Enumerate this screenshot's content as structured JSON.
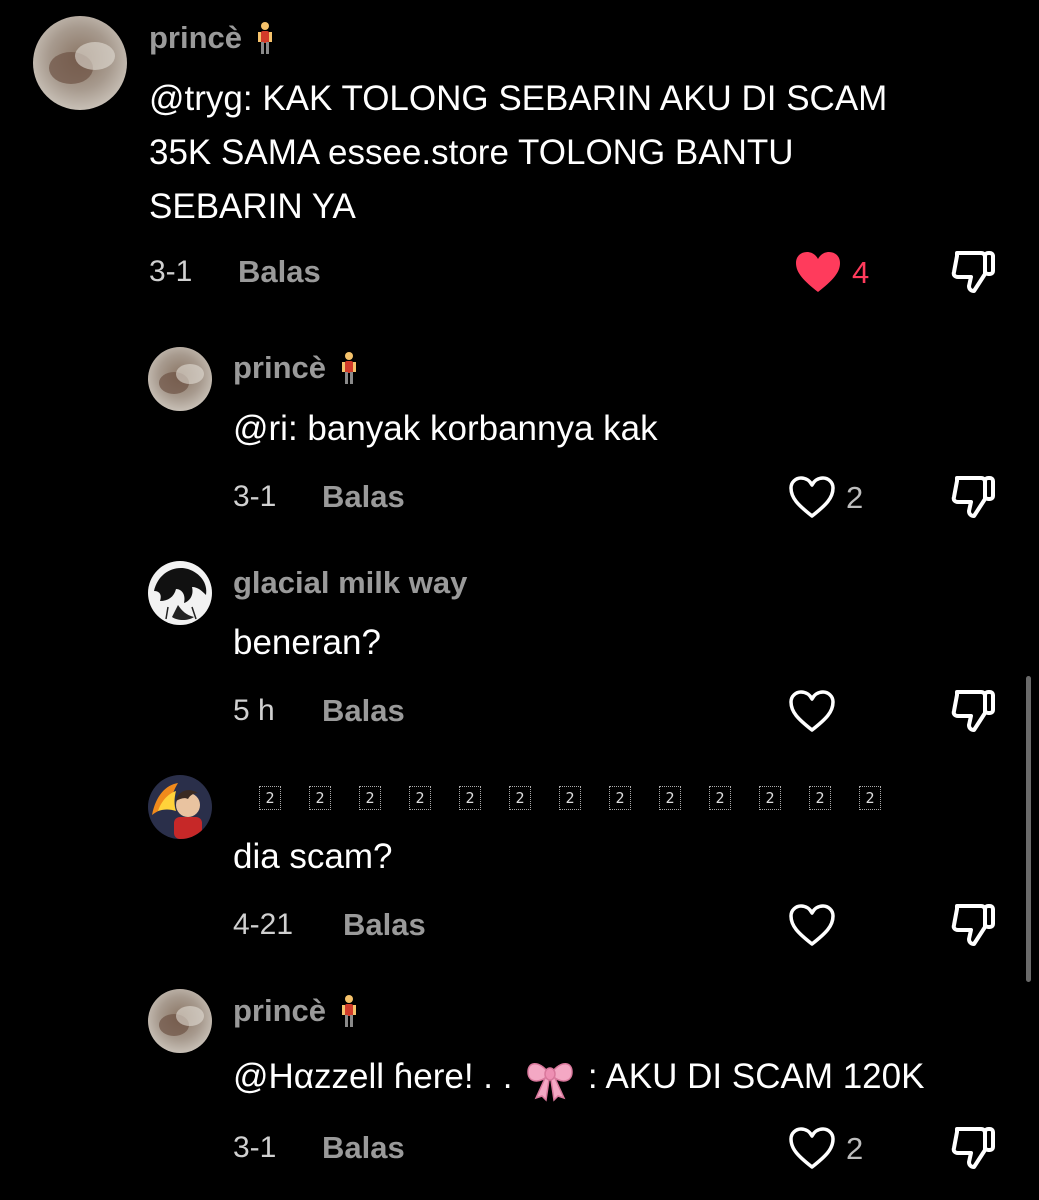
{
  "comments": [
    {
      "username": "princè",
      "text_lines": [
        "@tryg: KAK TOLONG SEBARIN AKU DI SCAM",
        "35K SAMA essee.store TOLONG BANTU",
        "SEBARIN YA"
      ],
      "time": "3-1",
      "reply_label": "Balas",
      "likes": "4",
      "liked": true
    },
    {
      "username": "princè",
      "text": "@ri: banyak korbannya kak",
      "time": "3-1",
      "reply_label": "Balas",
      "likes": "2",
      "liked": false
    },
    {
      "username": "glacial milk way",
      "text": "beneran?",
      "time": "5 h",
      "reply_label": "Balas",
      "likes": "",
      "liked": false
    },
    {
      "username_glyphs": [
        "2",
        "2",
        "2",
        "2",
        "2",
        "2",
        "2",
        "2",
        "2",
        "2",
        "2",
        "2",
        "2"
      ],
      "text": "dia scam?",
      "time": "4-21",
      "reply_label": "Balas",
      "likes": "",
      "liked": false
    },
    {
      "username": "princè",
      "text_prefix": "@Hαzzell ɦere! . .",
      "text_suffix": ": AKU DI SCAM 120K",
      "time": "3-1",
      "reply_label": "Balas",
      "likes": "2",
      "liked": false
    }
  ],
  "icons": {
    "like": "heart-icon",
    "dislike": "thumbs-down-icon",
    "user_emoji": "standing-person-emoji",
    "ribbon": "ribbon-emoji"
  },
  "colors": {
    "background": "#000000",
    "liked_heart": "#ff3b5c",
    "muted_text": "#9a9a9a"
  }
}
